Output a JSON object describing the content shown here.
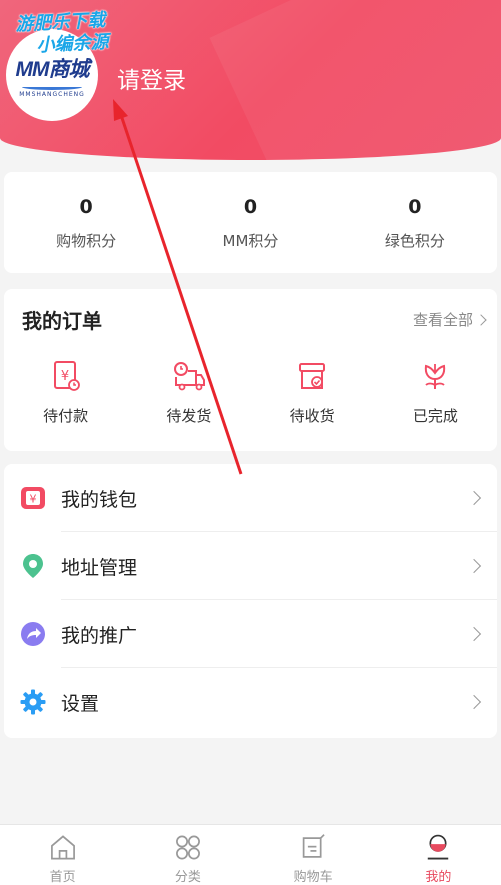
{
  "header": {
    "login_label": "请登录",
    "logo_text": "MM商城",
    "logo_subtext": "MMSHANGCHENG",
    "watermark_line1": "游肥乐下载",
    "watermark_line2": "小编余源"
  },
  "points": [
    {
      "value": "0",
      "label": "购物积分"
    },
    {
      "value": "0",
      "label": "MM积分"
    },
    {
      "value": "0",
      "label": "绿色积分"
    }
  ],
  "orders": {
    "title": "我的订单",
    "view_all": "查看全部",
    "items": [
      {
        "label": "待付款",
        "icon": "payment-icon"
      },
      {
        "label": "待发货",
        "icon": "truck-icon"
      },
      {
        "label": "待收货",
        "icon": "box-icon"
      },
      {
        "label": "已完成",
        "icon": "flower-icon"
      }
    ]
  },
  "menu": [
    {
      "label": "我的钱包",
      "icon": "wallet-icon",
      "color": "#f24b63"
    },
    {
      "label": "地址管理",
      "icon": "location-icon",
      "color": "#4cc28f"
    },
    {
      "label": "我的推广",
      "icon": "share-icon",
      "color": "#8a7cf0"
    },
    {
      "label": "设置",
      "icon": "gear-icon",
      "color": "#2a9df4"
    }
  ],
  "tabs": [
    {
      "label": "首页",
      "icon": "home-icon",
      "active": false
    },
    {
      "label": "分类",
      "icon": "category-icon",
      "active": false
    },
    {
      "label": "购物车",
      "icon": "cart-icon",
      "active": false
    },
    {
      "label": "我的",
      "icon": "profile-icon",
      "active": true
    }
  ],
  "colors": {
    "brand": "#f24b63",
    "tab_active": "#e84a5f"
  }
}
